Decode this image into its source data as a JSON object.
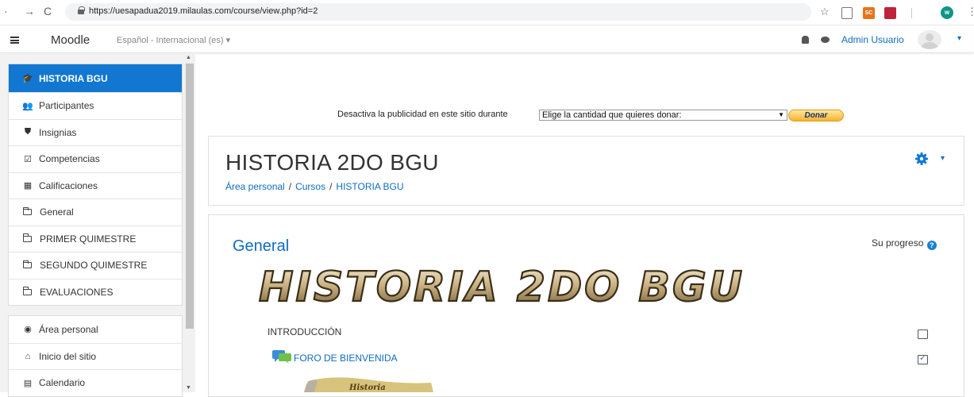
{
  "browser": {
    "url": "https://uesapadua2019.milaulas.com/course/view.php?id=2",
    "profile_initial": "w",
    "ext_sc_label": "SC"
  },
  "navbar": {
    "brand": "Moodle",
    "language": "Español - Internacional (es)",
    "user_name": "Admin Usuario"
  },
  "drawer": {
    "course_items": [
      {
        "label": "HISTORIA BGU",
        "icon": "graduation-cap-icon",
        "active": true
      },
      {
        "label": "Participantes",
        "icon": "users-icon"
      },
      {
        "label": "Insignias",
        "icon": "shield-icon"
      },
      {
        "label": "Competencias",
        "icon": "checkbox-icon"
      },
      {
        "label": "Calificaciones",
        "icon": "table-icon"
      },
      {
        "label": "General",
        "icon": "folder-icon"
      },
      {
        "label": "PRIMER QUIMESTRE",
        "icon": "folder-icon"
      },
      {
        "label": "SEGUNDO QUIMESTRE",
        "icon": "folder-icon"
      },
      {
        "label": "EVALUACIONES",
        "icon": "folder-icon"
      }
    ],
    "site_items": [
      {
        "label": "Área personal",
        "icon": "dashboard-icon"
      },
      {
        "label": "Inicio del sitio",
        "icon": "home-icon"
      },
      {
        "label": "Calendario",
        "icon": "calendar-icon"
      }
    ]
  },
  "ad": {
    "text": "Desactiva la publicidad en este sitio durante",
    "select_value": "Elige la cantidad que quieres donar:",
    "button": "Donar"
  },
  "header": {
    "title": "HISTORIA 2DO BGU",
    "breadcrumb": [
      "Área personal",
      "Cursos",
      "HISTORIA BGU"
    ],
    "separator": "/"
  },
  "section": {
    "title": "General",
    "progress_label": "Su progreso",
    "banner_text": "HISTORIA 2DO BGU",
    "activities": [
      {
        "label": "INTRODUCCIÓN",
        "completed": false
      },
      {
        "label": "FORO DE BIENVENIDA",
        "completed": true
      }
    ],
    "thumbnail_text": "Historia"
  },
  "colors": {
    "accent": "#1177d1",
    "link": "#0f6cbf"
  }
}
